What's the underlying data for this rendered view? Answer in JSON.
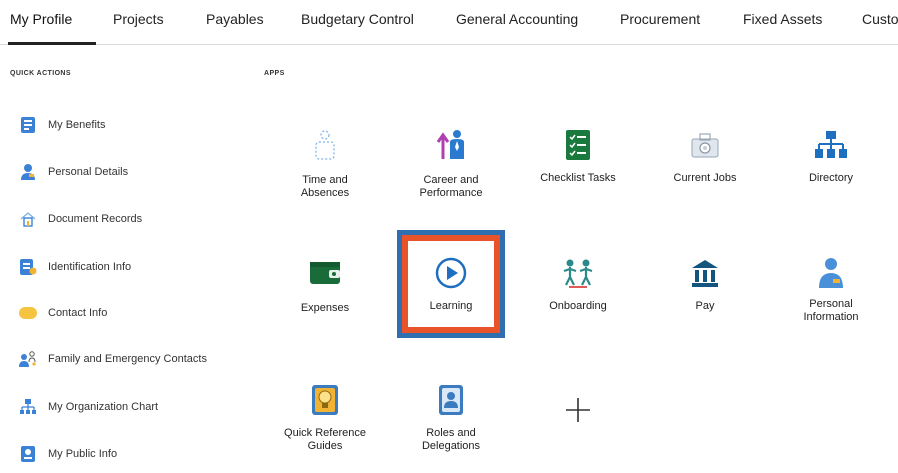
{
  "tabs": [
    {
      "label": "My Profile"
    },
    {
      "label": "Projects"
    },
    {
      "label": "Payables"
    },
    {
      "label": "Budgetary Control"
    },
    {
      "label": "General Accounting"
    },
    {
      "label": "Procurement"
    },
    {
      "label": "Fixed Assets"
    },
    {
      "label": "Custo"
    }
  ],
  "active_tab": "My Profile",
  "quick_actions": {
    "heading": "QUICK ACTIONS",
    "items": [
      {
        "label": "My Benefits",
        "icon": "benefits-icon"
      },
      {
        "label": "Personal Details",
        "icon": "person-icon"
      },
      {
        "label": "Document Records",
        "icon": "document-icon"
      },
      {
        "label": "Identification Info",
        "icon": "id-card-icon"
      },
      {
        "label": "Contact Info",
        "icon": "contact-icon"
      },
      {
        "label": "Family and Emergency Contacts",
        "icon": "family-icon"
      },
      {
        "label": "My Organization Chart",
        "icon": "org-chart-icon"
      },
      {
        "label": "My Public Info",
        "icon": "public-info-icon"
      }
    ]
  },
  "apps": {
    "heading": "APPS",
    "tiles": [
      {
        "label_lines": [
          "Time and",
          "Absences"
        ],
        "icon": "time-absences-icon"
      },
      {
        "label_lines": [
          "Career and",
          "Performance"
        ],
        "icon": "career-performance-icon"
      },
      {
        "label_lines": [
          "Checklist Tasks"
        ],
        "icon": "checklist-icon"
      },
      {
        "label_lines": [
          "Current Jobs"
        ],
        "icon": "current-jobs-icon"
      },
      {
        "label_lines": [
          "Directory"
        ],
        "icon": "directory-icon"
      },
      {
        "label_lines": [
          "Expenses"
        ],
        "icon": "wallet-icon"
      },
      {
        "label_lines": [
          "Learning"
        ],
        "icon": "play-icon"
      },
      {
        "label_lines": [
          "Onboarding"
        ],
        "icon": "onboarding-icon"
      },
      {
        "label_lines": [
          "Pay"
        ],
        "icon": "bank-icon"
      },
      {
        "label_lines": [
          "Personal",
          "Information"
        ],
        "icon": "personal-info-icon"
      },
      {
        "label_lines": [
          "Quick Reference",
          "Guides"
        ],
        "icon": "lightbulb-icon"
      },
      {
        "label_lines": [
          "Roles and",
          "Delegations"
        ],
        "icon": "roles-icon"
      }
    ],
    "add_tile": {
      "icon": "plus-icon"
    }
  },
  "colors": {
    "accent_blue": "#2f6fb0",
    "highlight_orange": "#e8532a",
    "icon_blue": "#1f6fc0",
    "icon_green": "#1a7a3d"
  }
}
